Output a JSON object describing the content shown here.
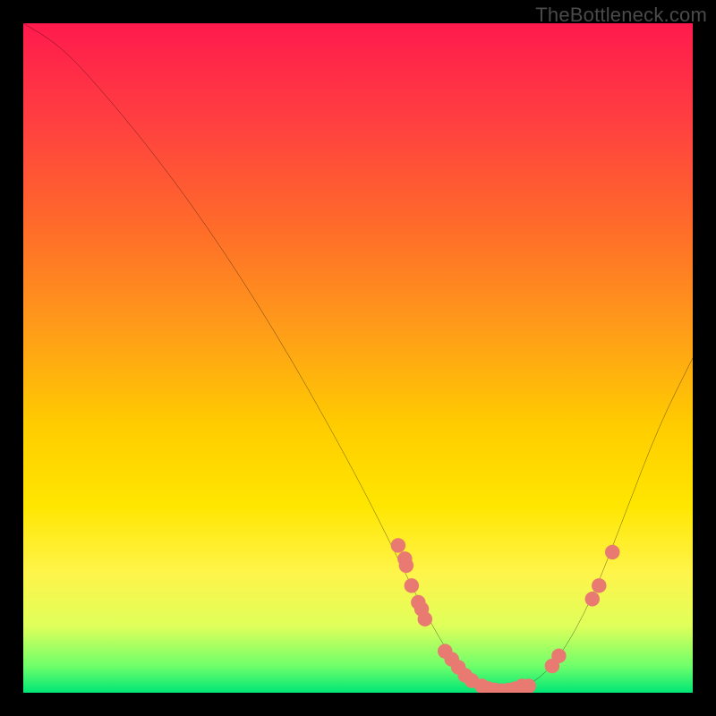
{
  "watermark": "TheBottleneck.com",
  "colors": {
    "dot": "#e87a72",
    "curve": "#000000"
  },
  "chart_data": {
    "type": "line",
    "title": "",
    "xlabel": "",
    "ylabel": "",
    "xlim": [
      0,
      100
    ],
    "ylim": [
      0,
      100
    ],
    "curve": [
      {
        "x": 0,
        "y": 100
      },
      {
        "x": 5,
        "y": 97
      },
      {
        "x": 10,
        "y": 92
      },
      {
        "x": 20,
        "y": 80
      },
      {
        "x": 30,
        "y": 66
      },
      {
        "x": 40,
        "y": 50
      },
      {
        "x": 50,
        "y": 32
      },
      {
        "x": 56,
        "y": 20
      },
      {
        "x": 60,
        "y": 12
      },
      {
        "x": 64,
        "y": 5
      },
      {
        "x": 68,
        "y": 1.2
      },
      {
        "x": 72,
        "y": 0.3
      },
      {
        "x": 76,
        "y": 1.2
      },
      {
        "x": 80,
        "y": 5
      },
      {
        "x": 85,
        "y": 14
      },
      {
        "x": 90,
        "y": 27
      },
      {
        "x": 95,
        "y": 40
      },
      {
        "x": 100,
        "y": 50
      }
    ],
    "dots": [
      {
        "x": 56,
        "y": 22
      },
      {
        "x": 57,
        "y": 20
      },
      {
        "x": 57.2,
        "y": 19
      },
      {
        "x": 58,
        "y": 16
      },
      {
        "x": 59,
        "y": 13.5
      },
      {
        "x": 59.5,
        "y": 12.5
      },
      {
        "x": 60,
        "y": 11
      },
      {
        "x": 63,
        "y": 6.2
      },
      {
        "x": 64,
        "y": 5
      },
      {
        "x": 65,
        "y": 3.8
      },
      {
        "x": 66,
        "y": 2.6
      },
      {
        "x": 67,
        "y": 1.8
      },
      {
        "x": 68.5,
        "y": 1.0
      },
      {
        "x": 69.5,
        "y": 0.6
      },
      {
        "x": 70.5,
        "y": 0.4
      },
      {
        "x": 71.5,
        "y": 0.3
      },
      {
        "x": 72.5,
        "y": 0.4
      },
      {
        "x": 73.5,
        "y": 0.6
      },
      {
        "x": 74.5,
        "y": 1.0
      },
      {
        "x": 75.5,
        "y": 1.0
      },
      {
        "x": 79,
        "y": 4.0
      },
      {
        "x": 80,
        "y": 5.5
      },
      {
        "x": 85,
        "y": 14
      },
      {
        "x": 86,
        "y": 16
      },
      {
        "x": 88,
        "y": 21
      }
    ],
    "dot_radius": 1.1
  }
}
